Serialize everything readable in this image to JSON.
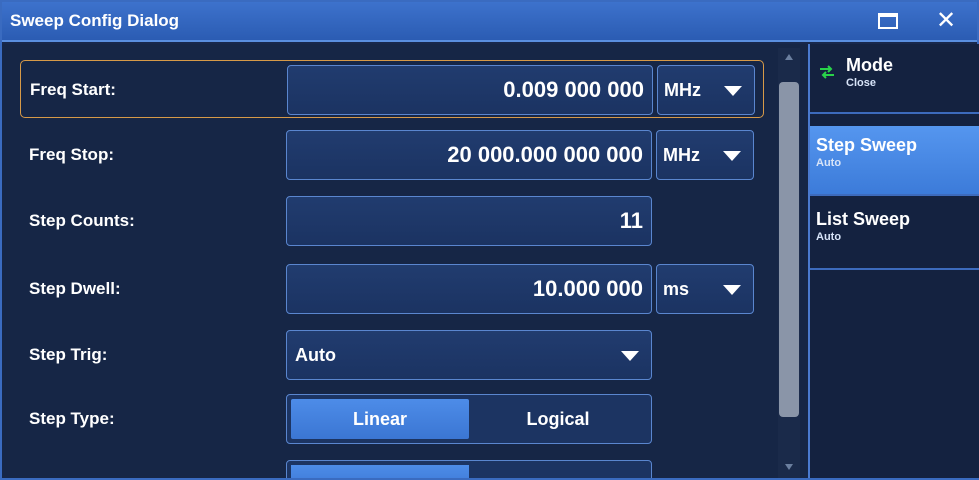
{
  "window": {
    "title": "Sweep Config Dialog"
  },
  "fields": {
    "freq_start": {
      "label": "Freq Start:",
      "value": "0.009 000 000",
      "unit": "MHz"
    },
    "freq_stop": {
      "label": "Freq Stop:",
      "value": "20 000.000 000 000",
      "unit": "MHz"
    },
    "step_counts": {
      "label": "Step Counts:",
      "value": "11"
    },
    "step_dwell": {
      "label": "Step Dwell:",
      "value": "10.000 000",
      "unit": "ms"
    },
    "step_trig": {
      "label": "Step Trig:",
      "value": "Auto"
    },
    "step_type": {
      "label": "Step Type:",
      "options": [
        "Linear",
        "Logical"
      ],
      "selected": "Linear"
    }
  },
  "softkeys": {
    "mode": {
      "title": "Mode",
      "sub": "Close",
      "icon": "sweep-mode-icon"
    },
    "step_sweep": {
      "title": "Step Sweep",
      "sub": "Auto",
      "active": true
    },
    "list_sweep": {
      "title": "List Sweep",
      "sub": "Auto"
    }
  },
  "colors": {
    "titlebar": "#3d72cc",
    "accent": "#4d8ce8",
    "focus_border": "#d79a48",
    "background": "#162646"
  }
}
